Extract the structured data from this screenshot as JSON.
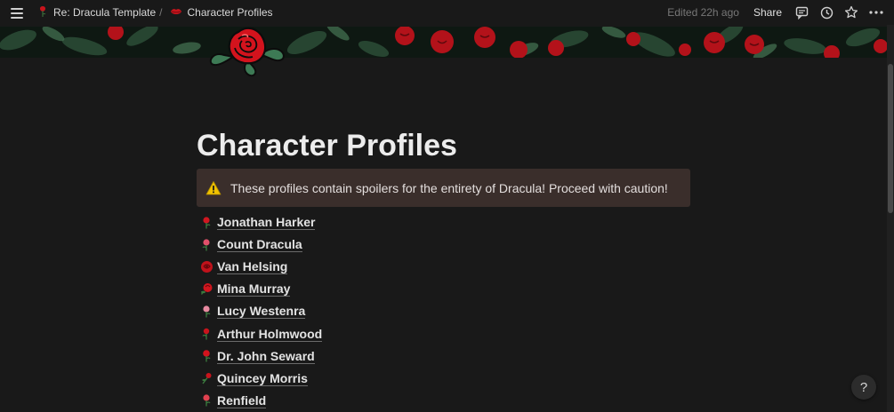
{
  "breadcrumb": {
    "parent": "Re: Dracula Template",
    "separator": "/",
    "current": "Character Profiles"
  },
  "topbar": {
    "edited": "Edited 22h ago",
    "share": "Share",
    "icons": [
      "comment-icon",
      "history-icon",
      "star-icon",
      "more-icon"
    ]
  },
  "page": {
    "title": "Character Profiles",
    "callout": {
      "icon": "warning-icon",
      "text": "These profiles contain spoilers for the entirety of Dracula! Proceed with caution!"
    },
    "characters": [
      {
        "label": "Jonathan Harker",
        "icon": "rose-stem-icon"
      },
      {
        "label": "Count Dracula",
        "icon": "rose-stem-icon"
      },
      {
        "label": "Van Helsing",
        "icon": "rose-bloom-icon"
      },
      {
        "label": "Mina Murray",
        "icon": "rose-bloom-icon"
      },
      {
        "label": "Lucy Westenra",
        "icon": "rose-stem-icon"
      },
      {
        "label": "Arthur Holmwood",
        "icon": "rose-stem-icon"
      },
      {
        "label": "Dr. John Seward",
        "icon": "rose-stem-icon"
      },
      {
        "label": "Quincey Morris",
        "icon": "rose-stem-icon"
      },
      {
        "label": "Renfield",
        "icon": "rose-stem-icon"
      }
    ]
  },
  "help": "?",
  "colors": {
    "background": "#191919",
    "callout_bg": "#3a2e2b",
    "rose_red": "#c8141c",
    "leaf_green": "#2f5a3f"
  }
}
